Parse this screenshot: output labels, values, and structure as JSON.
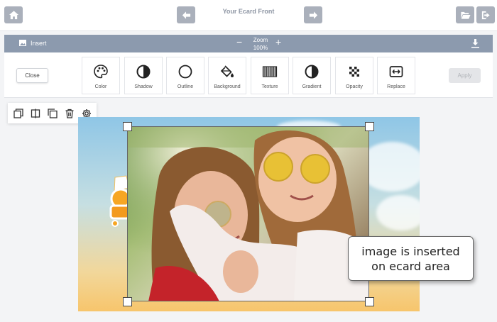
{
  "header": {
    "title": "Your Ecard Front",
    "home_icon": "home-icon",
    "prev_icon": "arrow-left-icon",
    "next_icon": "arrow-right-icon",
    "open_icon": "folder-open-icon",
    "exit_icon": "exit-icon"
  },
  "toolbar": {
    "insert_label": "Insert",
    "zoom_label": "Zoom",
    "zoom_value": "100%",
    "zoom_minus": "−",
    "zoom_plus": "+"
  },
  "panel": {
    "close_label": "Close",
    "apply_label": "Apply",
    "tools": [
      {
        "label": "Color",
        "icon": "palette-icon"
      },
      {
        "label": "Shadow",
        "icon": "half-circle-icon"
      },
      {
        "label": "Outline",
        "icon": "circle-outline-icon"
      },
      {
        "label": "Background",
        "icon": "paint-bucket-icon"
      },
      {
        "label": "Texture",
        "icon": "texture-icon"
      },
      {
        "label": "Gradient",
        "icon": "gradient-icon"
      },
      {
        "label": "Opacity",
        "icon": "checkerboard-icon"
      },
      {
        "label": "Replace",
        "icon": "replace-icon"
      }
    ]
  },
  "mini_tools": [
    "duplicate-icon",
    "flip-icon",
    "layer-icon",
    "trash-icon",
    "gear-icon"
  ],
  "callout": {
    "line1": "image is inserted",
    "line2": "on ecard area"
  },
  "colors": {
    "toolbar_bg": "#8c9aae",
    "button_bg": "#aab0bb",
    "title_color": "#8d95a3"
  }
}
